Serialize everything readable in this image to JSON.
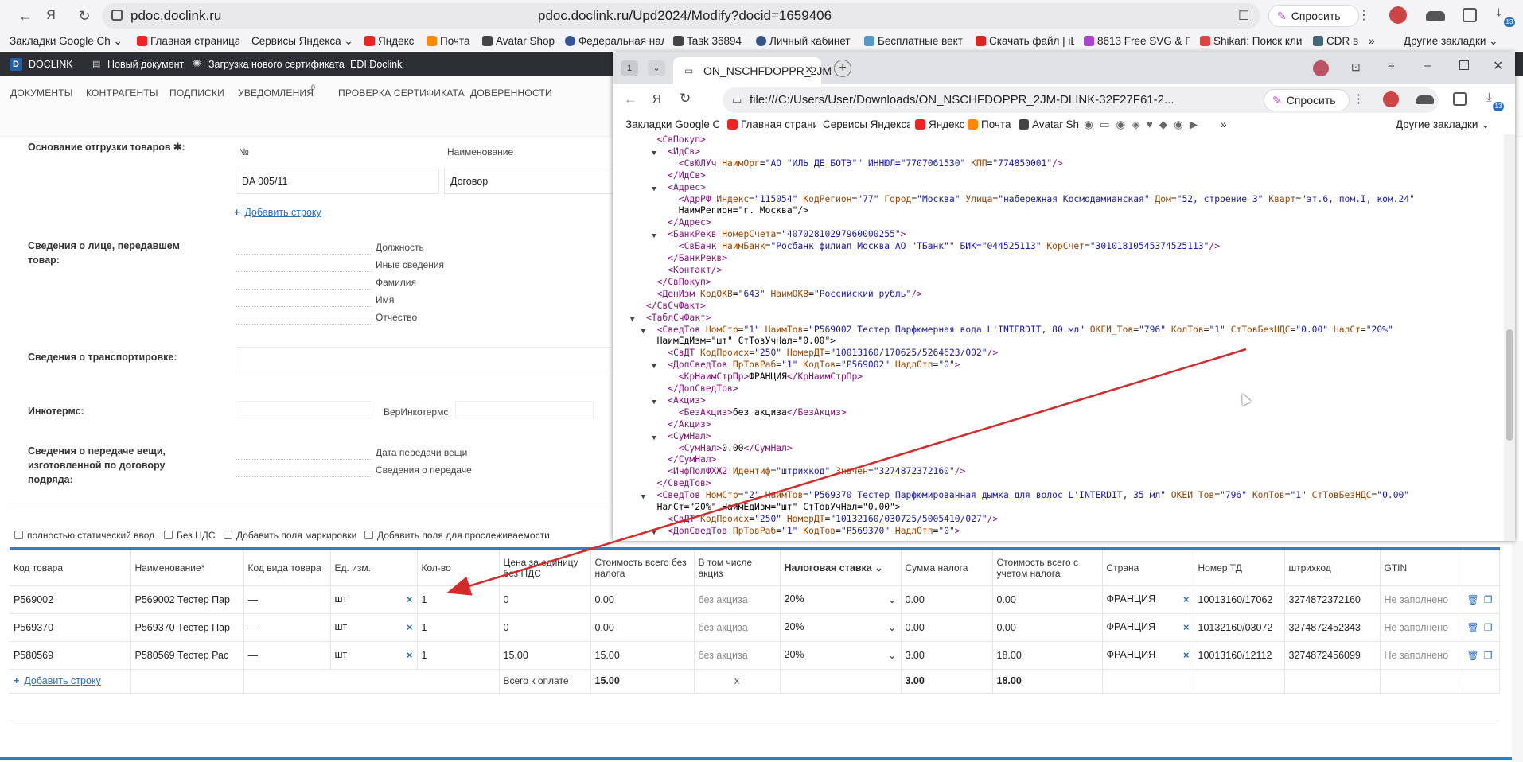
{
  "browser": {
    "url_host": "pdoc.doclink.ru",
    "url_full": "pdoc.doclink.ru/Upd2024/Modify?docid=1659406",
    "ask_label": "Спросить",
    "other_bookmarks": "Другие закладки",
    "bookmarks": [
      "Закладки Google Ch",
      "Главная страница",
      "Сервисы Яндекса",
      "Яндекс",
      "Почта",
      "Avatar Shop",
      "Федеральная нал",
      "Task 36894",
      "Личный кабинет",
      "Бесплатные вект",
      "Скачать файл | iL",
      "8613 Free SVG & P",
      "Shikari: Поиск кли",
      "CDR в"
    ]
  },
  "app": {
    "brand": "DOCLINK",
    "top_links": [
      "Новый документ",
      "Загрузка нового сертификата",
      "EDI.Doclink"
    ],
    "nav": [
      "ДОКУМЕНТЫ",
      "КОНТРАГЕНТЫ",
      "ПОДПИСКИ",
      "УВЕДОМЛЕНИЯ",
      "ПРОВЕРКА СЕРТИФИКАТА",
      "ДОВЕРЕННОСТИ"
    ],
    "notif_count": "0"
  },
  "form": {
    "basis_label": "Основание отгрузки товаров ✱:",
    "col_num": "№",
    "col_name": "Наименование",
    "basis_num": "DA 005/11",
    "basis_name": "Договор",
    "add_row": "Добавить строку",
    "person_label": "Сведения о лице, передавшем товар:",
    "person_fields": [
      "Должность",
      "Иные сведения",
      "Фамилия",
      "Имя",
      "Отчество"
    ],
    "transport_label": "Сведения о транспортировке:",
    "incoterms_label": "Инкотермс:",
    "incoterms_ver": "ВерИнкотермс",
    "transfer_label": "Сведения о передаче вещи, изготовленной по договору подряда:",
    "transfer_fields": [
      "Дата передачи вещи",
      "Сведения о передаче"
    ]
  },
  "checks": [
    "полностью статический ввод",
    "Без НДС",
    "Добавить поля маркировки",
    "Добавить поля для прослеживаемости"
  ],
  "table": {
    "headers": [
      "Код товара",
      "Наименование*",
      "Код вида товара",
      "Ед. изм.",
      "Кол-во",
      "Цена за единицу без НДС",
      "Стоимость всего без налога",
      "В том числе акциз",
      "Налоговая ставка",
      "Сумма налога",
      "Стоимость всего с учетом налога",
      "Страна",
      "Номер ТД",
      "штрихкод",
      "GTIN"
    ],
    "rows": [
      [
        "P569002",
        "P569002 Тестер Пар",
        "—",
        "шт",
        "1",
        "0",
        "0.00",
        "без акциза",
        "20%",
        "0.00",
        "0.00",
        "ФРАНЦИЯ",
        "10013160/17062",
        "3274872372160",
        "Не заполнено"
      ],
      [
        "P569370",
        "P569370 Тестер Пар",
        "—",
        "шт",
        "1",
        "0",
        "0.00",
        "без акциза",
        "20%",
        "0.00",
        "0.00",
        "ФРАНЦИЯ",
        "10132160/03072",
        "3274872452343",
        "Не заполнено"
      ],
      [
        "P580569",
        "P580569 Тестер Рас",
        "—",
        "шт",
        "1",
        "15.00",
        "15.00",
        "без акциза",
        "20%",
        "3.00",
        "18.00",
        "ФРАНЦИЯ",
        "10013160/12112",
        "3274872456099",
        "Не заполнено"
      ]
    ],
    "add_row": "Добавить строку",
    "total_label": "Всего к оплате",
    "total_net": "15.00",
    "total_x": "x",
    "total_tax": "3.00",
    "total_gross": "18.00"
  },
  "xml_window": {
    "tab_count": "1",
    "tab_title": "ON_NSCHFDOPPR_2JM",
    "address": "file:///C:/Users/User/Downloads/ON_NSCHFDOPPR_2JM-DLINK-32F27F61-2...",
    "ask_label": "Спросить",
    "other_bookmarks": "Другие закладки",
    "bookmarks": [
      "Закладки Google Ch",
      "Главная страница",
      "Сервисы Яндекса",
      "Яндекс",
      "Почта",
      "Avatar Shop"
    ],
    "lines": [
      "  <СвПокуп>",
      "    <ИдСв>",
      "      <СвЮЛУч НаимОрг=\"АО \"ИЛЬ ДЕ БОТЭ\"\" ИННЮЛ=\"7707061530\" КПП=\"774850001\"/>",
      "    </ИдСв>",
      "    <Адрес>",
      "      <АдрРФ Индекс=\"115054\" КодРегион=\"77\" Город=\"Москва\" Улица=\"набережная Космодамианская\" Дом=\"52, строение 3\" Кварт=\"эт.6, пом.I, ком.24\"",
      "      НаимРегион=\"г. Москва\"/>",
      "    </Адрес>",
      "    <БанкРекв НомерСчета=\"40702810297960000255\">",
      "      <СвБанк НаимБанк=\"Росбанк филиал Москва АО \"ТБанк\"\" БИК=\"044525113\" КорСчет=\"30101810545374525113\"/>",
      "    </БанкРекв>",
      "    <Контакт/>",
      "  </СвПокуп>",
      "  <ДенИзм КодОКВ=\"643\" НаимОКВ=\"Российский рубль\"/>",
      "</СвСчФакт>",
      "<ТаблСчФакт>",
      "  <СведТов НомСтр=\"1\" НаимТов=\"P569002 Тестер Парфюмерная вода L'INTERDIT, 80 мл\" ОКЕИ_Тов=\"796\" КолТов=\"1\" СтТовБезНДС=\"0.00\" НалСт=\"20%\"",
      "  НаимЕдИзм=\"шт\" СтТовУчНал=\"0.00\">",
      "    <СвДТ КодПроисх=\"250\" НомерДТ=\"10013160/170625/5264623/002\"/>",
      "    <ДопСведТов ПрТовРаб=\"1\" КодТов=\"P569002\" НадлОтп=\"0\">",
      "      <КрНаимСтрПр>ФРАНЦИЯ</КрНаимСтрПр>",
      "    </ДопСведТов>",
      "    <Акциз>",
      "      <БезАкциз>без акциза</БезАкциз>",
      "    </Акциз>",
      "    <СумНал>",
      "      <СумНал>0.00</СумНал>",
      "    </СумНал>",
      "    <ИнфПолФХЖ2 Идентиф=\"штрихкод\" Значен=\"3274872372160\"/>",
      "  </СведТов>",
      "  <СведТов НомСтр=\"2\" НаимТов=\"P569370 Тестер Парфюмированная дымка для волос L'INTERDIT, 35 мл\" ОКЕИ_Тов=\"796\" КолТов=\"1\" СтТовБезНДС=\"0.00\"",
      "  НалСт=\"20%\" НаимЕдИзм=\"шт\" СтТовУчНал=\"0.00\">",
      "    <СвДТ КодПроисх=\"250\" НомерДТ=\"10132160/030725/5005410/027\"/>",
      "    <ДопСведТов ПрТовРаб=\"1\" КодТов=\"P569370\" НадлОтп=\"0\">"
    ],
    "triangles": [
      0,
      1,
      0,
      0,
      1,
      0,
      0,
      0,
      1,
      0,
      0,
      0,
      0,
      0,
      0,
      1,
      1,
      0,
      0,
      1,
      0,
      0,
      1,
      0,
      0,
      1,
      0,
      0,
      0,
      0,
      1,
      0,
      0,
      1
    ]
  },
  "colors": {
    "accent": "#2f7fc1",
    "arrow": "#d42a2a",
    "app_top": "#2c2f33"
  }
}
